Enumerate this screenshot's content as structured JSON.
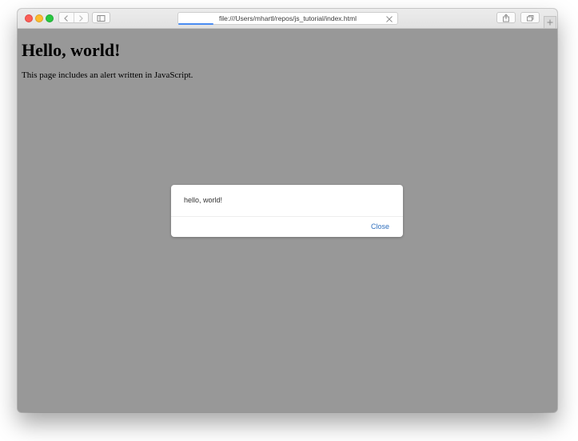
{
  "browser": {
    "address_bar": {
      "url": "file:///Users/mhartl/repos/js_tutorial/index.html",
      "load_progress": 0.16
    },
    "icons": {
      "back": "chevron-left-icon",
      "forward": "chevron-right-icon",
      "sidebar": "sidebar-icon",
      "stop": "close-icon",
      "share": "share-icon",
      "tabs": "tabs-icon",
      "new_tab": "plus-icon"
    },
    "colors": {
      "close_light": "#fc5f57",
      "minimize_light": "#fdbc2e",
      "zoom_light": "#28c840",
      "progress": "#4a8cf2"
    }
  },
  "page": {
    "heading": "Hello, world!",
    "text": "This page includes an alert written in JavaScript."
  },
  "alert": {
    "message": "hello, world!",
    "close_label": "Close",
    "link_color": "#2f6fbd"
  }
}
